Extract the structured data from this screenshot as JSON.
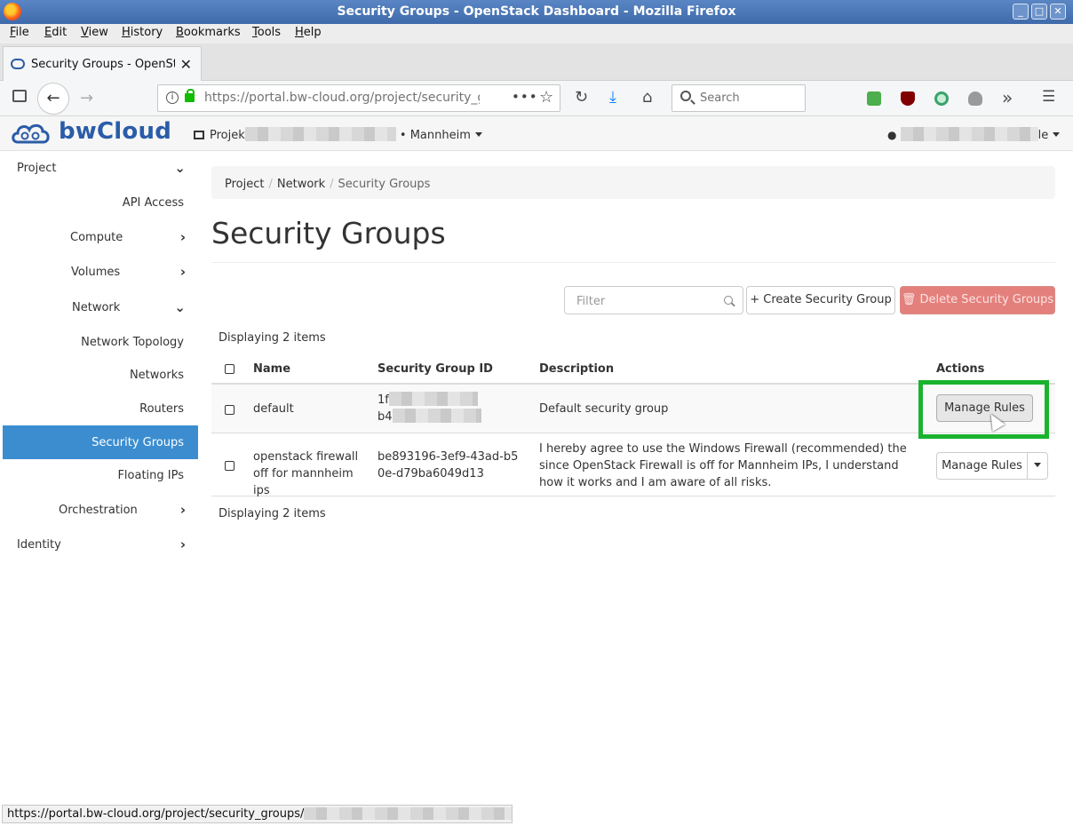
{
  "window": {
    "title": "Security Groups - OpenStack Dashboard - Mozilla Firefox",
    "controls": [
      "minimize",
      "maximize",
      "close"
    ]
  },
  "menubar": [
    "File",
    "Edit",
    "View",
    "History",
    "Bookmarks",
    "Tools",
    "Help"
  ],
  "tab": {
    "label": "Security Groups - OpenSta",
    "close": "✕"
  },
  "navbar": {
    "url": "https://portal.bw-cloud.org/project/security_group",
    "search_placeholder": "Search",
    "overflow": "»",
    "menu": "☰"
  },
  "header": {
    "brand": "bwCloud",
    "project_prefix": "Projek",
    "project_suffix": "• Mannheim",
    "user_suffix": "le"
  },
  "sidebar": {
    "items": [
      {
        "label": "Project",
        "chevron": "down"
      },
      {
        "label": "API Access"
      },
      {
        "label": "Compute",
        "chevron": "right"
      },
      {
        "label": "Volumes",
        "chevron": "right"
      },
      {
        "label": "Network",
        "chevron": "down"
      },
      {
        "label": "Network Topology"
      },
      {
        "label": "Networks"
      },
      {
        "label": "Routers"
      },
      {
        "label": "Security Groups",
        "active": true
      },
      {
        "label": "Floating IPs"
      },
      {
        "label": "Orchestration",
        "chevron": "right"
      },
      {
        "label": "Identity",
        "chevron": "right"
      }
    ]
  },
  "breadcrumb": [
    "Project",
    "Network",
    "Security Groups"
  ],
  "page_title": "Security Groups",
  "toolbar": {
    "filter_placeholder": "Filter",
    "create_label": "+ Create Security Group",
    "delete_label": "🗑 Delete Security Groups"
  },
  "table": {
    "count_text": "Displaying 2 items",
    "headers": [
      "Name",
      "Security Group ID",
      "Description",
      "Actions"
    ],
    "rows": [
      {
        "name": "default",
        "id_line1": "1f",
        "id_line2": "b4",
        "description": "Default security group",
        "action": "Manage Rules"
      },
      {
        "name": "openstack firewall off for mannheim ips",
        "id": "be893196-3ef9-43ad-b50e-d79ba6049d13",
        "description": "I hereby agree to use the Windows Firewall (recommended) the since OpenStack Firewall is off for Mannheim IPs, I understand how it works and I am aware of all risks.",
        "action": "Manage Rules"
      }
    ]
  },
  "statusbar": "https://portal.bw-cloud.org/project/security_groups/",
  "colors": {
    "active_nav": "#3b8dd0",
    "danger": "#e4807c",
    "highlight": "#1bb32e",
    "brand": "#2a5ca8"
  }
}
